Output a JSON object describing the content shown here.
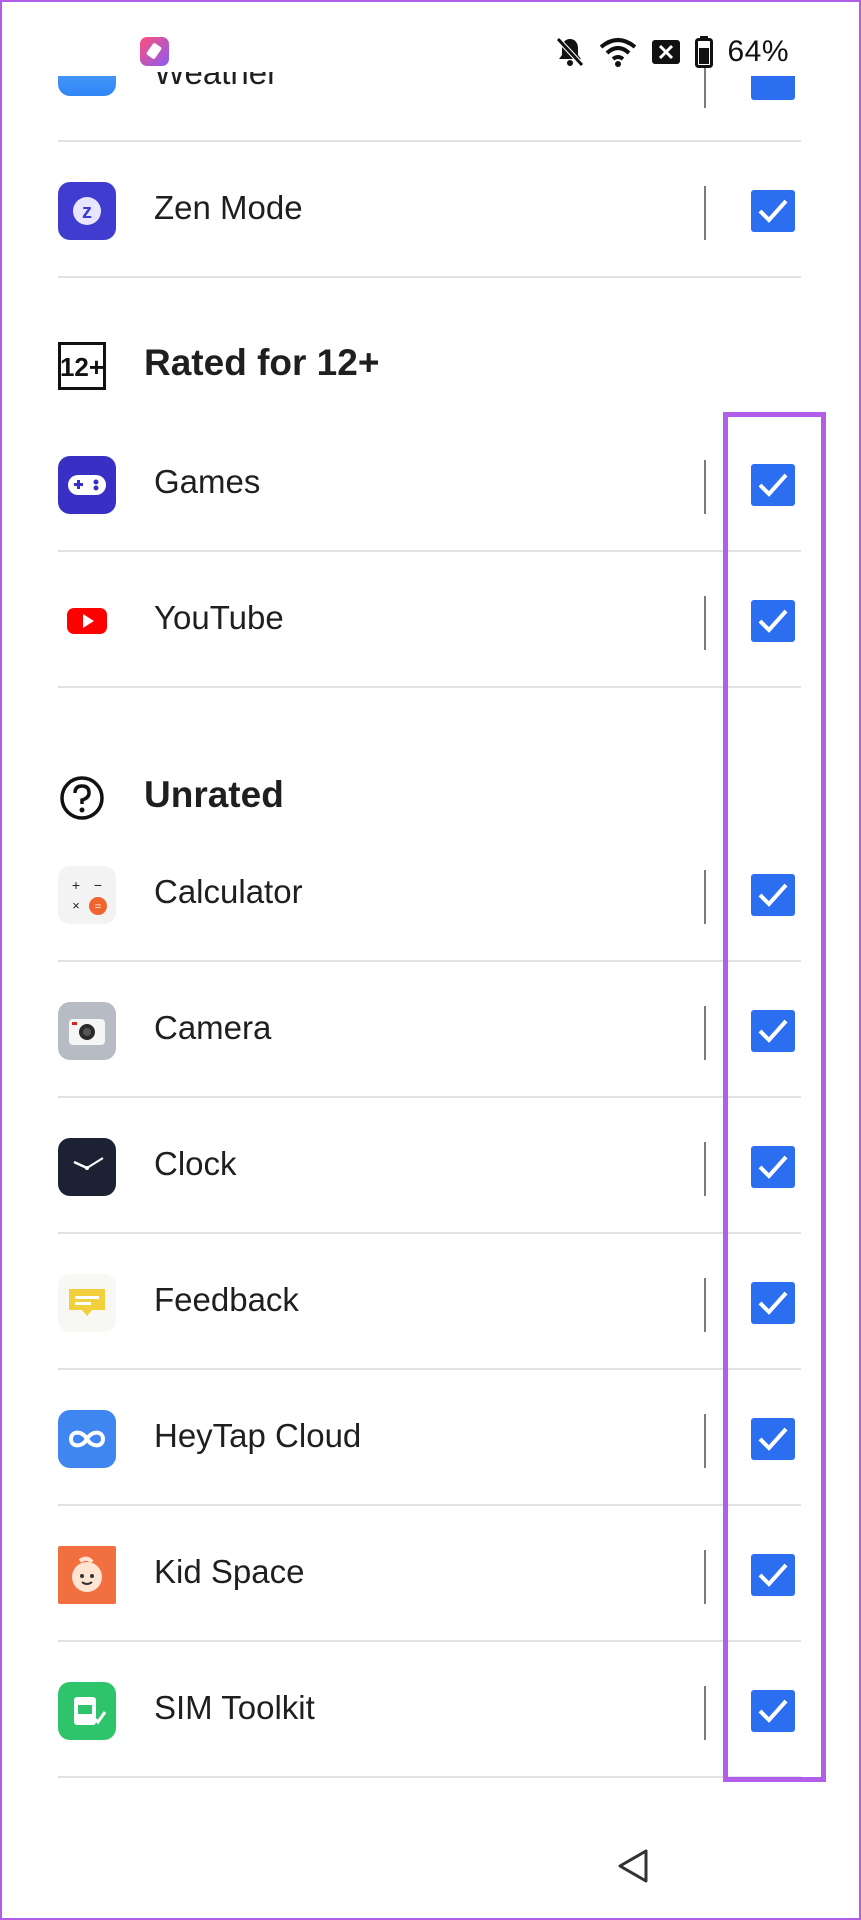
{
  "status_bar": {
    "battery_percent": "64%",
    "icons": [
      "app-notification-icon",
      "bell-muted-icon",
      "wifi-icon",
      "no-sim-icon",
      "battery-icon"
    ]
  },
  "partial_top": {
    "label": "Weather",
    "checked": true
  },
  "rows_top": [
    {
      "label": "Zen Mode",
      "icon": "zen-mode-icon",
      "checked": true
    }
  ],
  "sections": [
    {
      "title": "Rated for 12+",
      "icon": "rating-12-icon",
      "items": [
        {
          "label": "Games",
          "icon": "games-icon",
          "checked": true
        },
        {
          "label": "YouTube",
          "icon": "youtube-icon",
          "checked": true
        }
      ]
    },
    {
      "title": "Unrated",
      "icon": "question-circle-icon",
      "items": [
        {
          "label": "Calculator",
          "icon": "calculator-icon",
          "checked": true
        },
        {
          "label": "Camera",
          "icon": "camera-icon",
          "checked": true
        },
        {
          "label": "Clock",
          "icon": "clock-icon",
          "checked": true
        },
        {
          "label": "Feedback",
          "icon": "feedback-icon",
          "checked": true
        },
        {
          "label": "HeyTap Cloud",
          "icon": "heytap-cloud-icon",
          "checked": true
        },
        {
          "label": "Kid Space",
          "icon": "kid-space-icon",
          "checked": true
        },
        {
          "label": "SIM Toolkit",
          "icon": "sim-toolkit-icon",
          "checked": true
        }
      ]
    }
  ],
  "colors": {
    "accent": "#2b6ff0",
    "highlight": "#b15ee8"
  },
  "nav": {
    "back_icon": "back-triangle-icon"
  }
}
